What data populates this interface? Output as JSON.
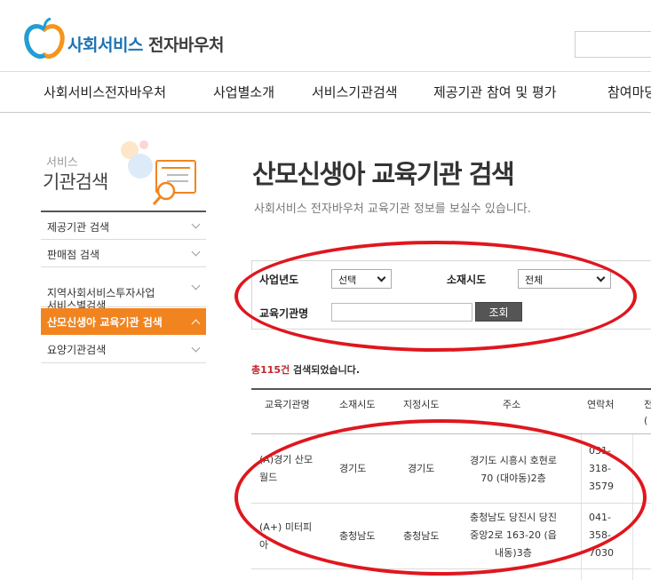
{
  "header": {
    "logo_brand": "사회서비스",
    "logo_rest": " 전자바우처"
  },
  "gnb": {
    "items": [
      "사회서비스전자바우처",
      "사업별소개",
      "서비스기관검색",
      "제공기관 참여 및 평가",
      "참여마당"
    ]
  },
  "sidebar": {
    "title_small": "서비스",
    "title_big": "기관검색",
    "items": [
      {
        "label": "제공기관 검색"
      },
      {
        "label": "판매점 검색"
      },
      {
        "label": "지역사회서비스투자사업\n서비스별검색"
      },
      {
        "label": "산모신생아 교육기관 검색"
      },
      {
        "label": "요양기관검색"
      }
    ]
  },
  "main": {
    "title": "산모신생아 교육기관 검색",
    "description": "사회서비스 전자바우처 교육기관 정보를 보실수 있습니다."
  },
  "search_form": {
    "year_label": "사업년도",
    "year_value": "선택",
    "region_label": "소재시도",
    "region_value": "전체",
    "name_label": "교육기관명",
    "name_value": "",
    "search_button": "조회"
  },
  "results": {
    "count": "총115건",
    "count_suffix": " 검색되었습니다.",
    "columns": [
      "교육기관명",
      "소재시도",
      "지정시도",
      "주소",
      "연락처",
      "전\n("
    ],
    "rows": [
      {
        "name": "(A)경기 산모\n월드",
        "region": "경기도",
        "designated": "경기도",
        "address": "경기도 시흥시 호현로\n70 (대야동)2층",
        "phone": "031-\n318-\n3579"
      },
      {
        "name": "(A+) 미터피\n아",
        "region": "충청남도",
        "designated": "충청남도",
        "address": "충청남도 당진시 당진\n중앙2로 163-20 (읍\n내동)3층",
        "phone": "041-\n358-\n7030"
      }
    ]
  },
  "colors": {
    "accent_orange": "#f2841f",
    "brand_blue": "#1e73b4",
    "count_red": "#c0272d",
    "annotation_red": "#e0161e"
  }
}
